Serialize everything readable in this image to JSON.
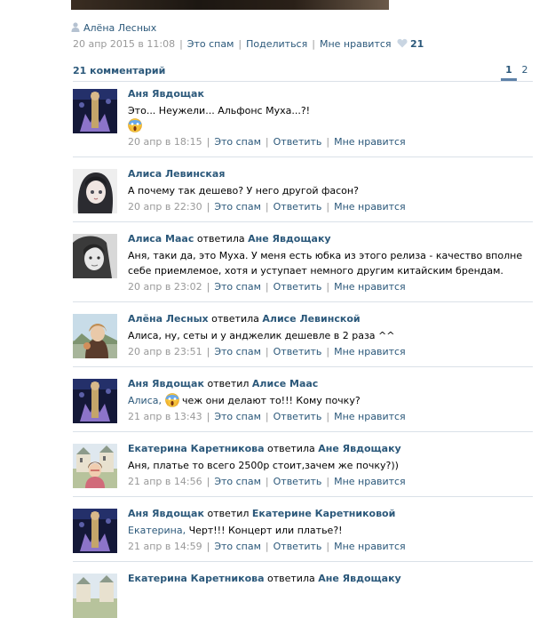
{
  "post": {
    "author": "Алёна Лесных",
    "date": "20 апр 2015 в 11:08",
    "spam": "Это спам",
    "share": "Поделиться",
    "like": "Мне нравится",
    "like_count": "21"
  },
  "comments_header": {
    "title": "21 комментарий",
    "pages": [
      "1",
      "2"
    ],
    "active_page": "1"
  },
  "comments": [
    {
      "author": "Аня Явдощак",
      "reply_word": "",
      "reply_to": "",
      "text_prefix": "",
      "text": "Это... Неужели... Альфонс Муха...?!",
      "date": "20 апр в 18:15",
      "spam": "Это спам",
      "reply": "Ответить",
      "like": "Мне нравится"
    },
    {
      "author": "Алиса Левинская",
      "reply_word": "",
      "reply_to": "",
      "text_prefix": "",
      "text": "А почему так дешево? У него другой фасон?",
      "date": "20 апр в 22:30",
      "spam": "Это спам",
      "reply": "Ответить",
      "like": "Мне нравится"
    },
    {
      "author": "Алиса Маас",
      "reply_word": "ответила",
      "reply_to": "Ане Явдощаку",
      "text_prefix": "",
      "text": "Аня, таки да, это Муха. У меня есть юбка из этого релиза - качество вполне себе приемлемое, хотя и уступает немного другим китайским брендам.",
      "date": "20 апр в 23:02",
      "spam": "Это спам",
      "reply": "Ответить",
      "like": "Мне нравится"
    },
    {
      "author": "Алёна Лесных",
      "reply_word": "ответила",
      "reply_to": "Алисе Левинской",
      "text_prefix": "",
      "text": "Алиса, ну, сеты и у анджелик дешевле в 2 раза ^^",
      "date": "20 апр в 23:51",
      "spam": "Это спам",
      "reply": "Ответить",
      "like": "Мне нравится"
    },
    {
      "author": "Аня Явдощак",
      "reply_word": "ответил",
      "reply_to": "Алисе Маас",
      "text_prefix": "Алиса,",
      "text": "чеж они делают то!!! Кому почку?",
      "date": "21 апр в 13:43",
      "spam": "Это спам",
      "reply": "Ответить",
      "like": "Мне нравится"
    },
    {
      "author": "Екатерина Каретникова",
      "reply_word": "ответила",
      "reply_to": "Ане Явдощаку",
      "text_prefix": "",
      "text": "Аня, платье то всего 2500р стоит,зачем же почку?))",
      "date": "21 апр в 14:56",
      "spam": "Это спам",
      "reply": "Ответить",
      "like": "Мне нравится"
    },
    {
      "author": "Аня Явдощак",
      "reply_word": "ответил",
      "reply_to": "Екатерине Каретниковой",
      "text_prefix": "Екатерина,",
      "text": "Черт!!! Концерт или платье?!",
      "date": "21 апр в 14:59",
      "spam": "Это спам",
      "reply": "Ответить",
      "like": "Мне нравится"
    },
    {
      "author": "Екатерина Каретникова",
      "reply_word": "ответила",
      "reply_to": "Ане Явдощаку",
      "text_prefix": "",
      "text": "",
      "date": "",
      "spam": "",
      "reply": "",
      "like": ""
    }
  ]
}
